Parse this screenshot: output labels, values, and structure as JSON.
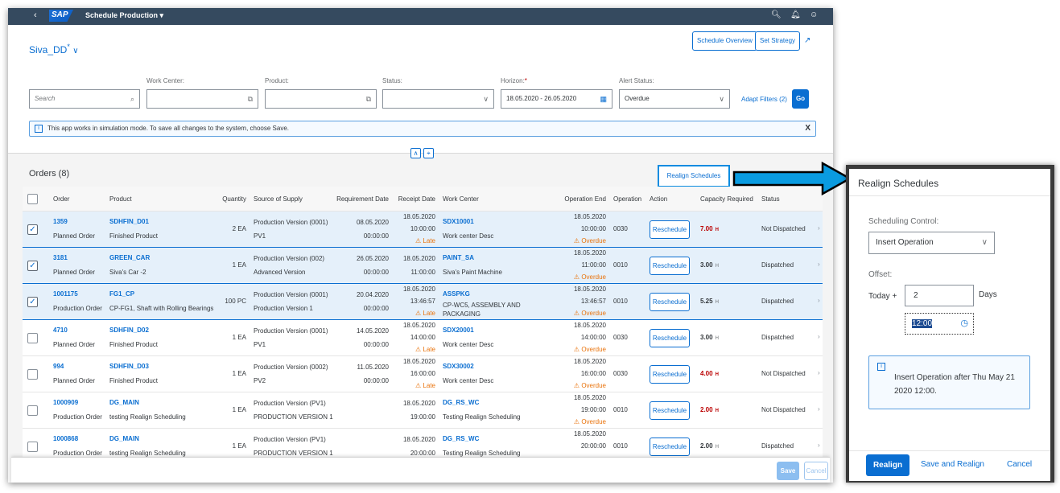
{
  "shell": {
    "title": "Schedule Production ▾",
    "logo": "SAP",
    "back_icon": "chevron-left-icon",
    "icons": [
      "search-icon",
      "bell-icon",
      "user-icon"
    ]
  },
  "header": {
    "variant": "Siva_DD",
    "variant_modified": "*",
    "schedule_overview": "Schedule Overview",
    "set_strategy": "Set Strategy"
  },
  "filters": {
    "search_placeholder": "Search",
    "work_center_label": "Work Center:",
    "work_center_value": "",
    "product_label": "Product:",
    "product_value": "",
    "status_label": "Status:",
    "status_value": "",
    "horizon_label": "Horizon:",
    "horizon_required": "*",
    "horizon_value": "18.05.2020 - 26.05.2020",
    "alert_status_label": "Alert Status:",
    "alert_status_value": "Overdue",
    "adapt_filters": "Adapt Filters (2)",
    "go": "Go"
  },
  "message_strip": {
    "text": "This app works in simulation mode. To save all changes to the system, choose Save.",
    "close": "X"
  },
  "table": {
    "title": "Orders (8)",
    "realign_button": "Realign Schedules",
    "columns": [
      "Order",
      "Product",
      "Quantity",
      "Source of Supply",
      "Requirement Date",
      "Receipt Date",
      "Work Center",
      "Operation End",
      "Operation",
      "Action",
      "Capacity Required",
      "Status"
    ],
    "rows": [
      {
        "selected": true,
        "order": "1359",
        "order_type": "Planned Order",
        "product": "SDHFIN_D01",
        "product_desc": "Finished Product",
        "quantity": "2 EA",
        "source": "Production Version (0001)",
        "source_desc": "PV1",
        "req_date": "08.05.2020",
        "req_time": "00:00:00",
        "receipt_date": "18.05.2020",
        "receipt_time": "10:00:00",
        "receipt_alert": "Late",
        "work_center": "SDX10001",
        "work_center_desc": "Work center Desc",
        "op_end_date": "18.05.2020",
        "op_end_time": "10:00:00",
        "op_end_alert": "Overdue",
        "operation": "0030",
        "action": "Reschedule",
        "capacity": "7.00",
        "capacity_unit": "H",
        "capacity_critical": true,
        "status": "Not Dispatched"
      },
      {
        "selected": true,
        "order": "3181",
        "order_type": "Planned Order",
        "product": "GREEN_CAR",
        "product_desc": "Siva's Car -2",
        "quantity": "1 EA",
        "source": "Production Version (002)",
        "source_desc": "Advanced Version",
        "req_date": "26.05.2020",
        "req_time": "00:00:00",
        "receipt_date": "18.05.2020",
        "receipt_time": "11:00:00",
        "receipt_alert": "",
        "work_center": "PAINT_SA",
        "work_center_desc": "Siva's Paint Machine",
        "op_end_date": "18.05.2020",
        "op_end_time": "11:00:00",
        "op_end_alert": "Overdue",
        "operation": "0010",
        "action": "Reschedule",
        "capacity": "3.00",
        "capacity_unit": "H",
        "capacity_critical": false,
        "status": "Dispatched"
      },
      {
        "selected": true,
        "order": "1001175",
        "order_type": "Production Order",
        "product": "FG1_CP",
        "product_desc": "CP-FG1, Shaft with Rolling Bearings",
        "quantity": "100 PC",
        "source": "Production Version (0001)",
        "source_desc": "Production Version 1",
        "req_date": "20.04.2020",
        "req_time": "00:00:00",
        "receipt_date": "18.05.2020",
        "receipt_time": "13:46:57",
        "receipt_alert": "Late",
        "work_center": "ASSPKG",
        "work_center_desc": "CP-WC5, ASSEMBLY AND PACKAGING",
        "op_end_date": "18.05.2020",
        "op_end_time": "13:46:57",
        "op_end_alert": "Overdue",
        "operation": "0010",
        "action": "Reschedule",
        "capacity": "5.25",
        "capacity_unit": "H",
        "capacity_critical": false,
        "status": "Dispatched"
      },
      {
        "selected": false,
        "order": "4710",
        "order_type": "Planned Order",
        "product": "SDHFIN_D02",
        "product_desc": "Finished Product",
        "quantity": "1 EA",
        "source": "Production Version (0001)",
        "source_desc": "PV1",
        "req_date": "14.05.2020",
        "req_time": "00:00:00",
        "receipt_date": "18.05.2020",
        "receipt_time": "14:00:00",
        "receipt_alert": "Late",
        "work_center": "SDX20001",
        "work_center_desc": "Work center Desc",
        "op_end_date": "18.05.2020",
        "op_end_time": "14:00:00",
        "op_end_alert": "Overdue",
        "operation": "0030",
        "action": "Reschedule",
        "capacity": "3.00",
        "capacity_unit": "H",
        "capacity_critical": false,
        "status": "Dispatched"
      },
      {
        "selected": false,
        "order": "994",
        "order_type": "Planned Order",
        "product": "SDHFIN_D03",
        "product_desc": "Finished Product",
        "quantity": "1 EA",
        "source": "Production Version (0002)",
        "source_desc": "PV2",
        "req_date": "11.05.2020",
        "req_time": "00:00:00",
        "receipt_date": "18.05.2020",
        "receipt_time": "16:00:00",
        "receipt_alert": "Late",
        "work_center": "SDX30002",
        "work_center_desc": "Work center Desc",
        "op_end_date": "18.05.2020",
        "op_end_time": "16:00:00",
        "op_end_alert": "Overdue",
        "operation": "0030",
        "action": "Reschedule",
        "capacity": "4.00",
        "capacity_unit": "H",
        "capacity_critical": true,
        "status": "Not Dispatched"
      },
      {
        "selected": false,
        "order": "1000909",
        "order_type": "Production Order",
        "product": "DG_MAIN",
        "product_desc": "testing Realign Scheduling",
        "quantity": "1 EA",
        "source": "Production Version (PV1)",
        "source_desc": "PRODUCTION VERSION 1",
        "req_date": "",
        "req_time": "",
        "receipt_date": "18.05.2020",
        "receipt_time": "19:00:00",
        "receipt_alert": "",
        "work_center": "DG_RS_WC",
        "work_center_desc": "Testing Realign Scheduling",
        "op_end_date": "18.05.2020",
        "op_end_time": "19:00:00",
        "op_end_alert": "Overdue",
        "operation": "0010",
        "action": "Reschedule",
        "capacity": "2.00",
        "capacity_unit": "H",
        "capacity_critical": true,
        "status": "Not Dispatched"
      },
      {
        "selected": false,
        "order": "1000868",
        "order_type": "Production Order",
        "product": "DG_MAIN",
        "product_desc": "testing Realign Scheduling",
        "quantity": "1 EA",
        "source": "Production Version (PV1)",
        "source_desc": "PRODUCTION VERSION 1",
        "req_date": "",
        "req_time": "",
        "receipt_date": "18.05.2020",
        "receipt_time": "20:00:00",
        "receipt_alert": "",
        "work_center": "DG_RS_WC",
        "work_center_desc": "Testing Realign Scheduling",
        "op_end_date": "18.05.2020",
        "op_end_time": "20:00:00",
        "op_end_alert": "",
        "operation": "0010",
        "action": "Reschedule",
        "capacity": "2.00",
        "capacity_unit": "H",
        "capacity_critical": false,
        "status": "Dispatched"
      }
    ]
  },
  "footer": {
    "save": "Save",
    "cancel": "Cancel"
  },
  "dialog": {
    "title": "Realign Schedules",
    "scheduling_control_label": "Scheduling Control:",
    "scheduling_control_value": "Insert Operation",
    "offset_label": "Offset:",
    "today_plus": "Today +",
    "days_value": "2",
    "days_label": "Days",
    "time_value": "12:00",
    "info_text": "Insert Operation after Thu May 21 2020 12:00.",
    "realign": "Realign",
    "save_and_realign": "Save and Realign",
    "cancel": "Cancel"
  },
  "colors": {
    "shell": "#354a5f",
    "accent": "#0a6ed1",
    "warning": "#e9730c",
    "critical": "#bb0000",
    "arrow": "#0a9be0"
  }
}
